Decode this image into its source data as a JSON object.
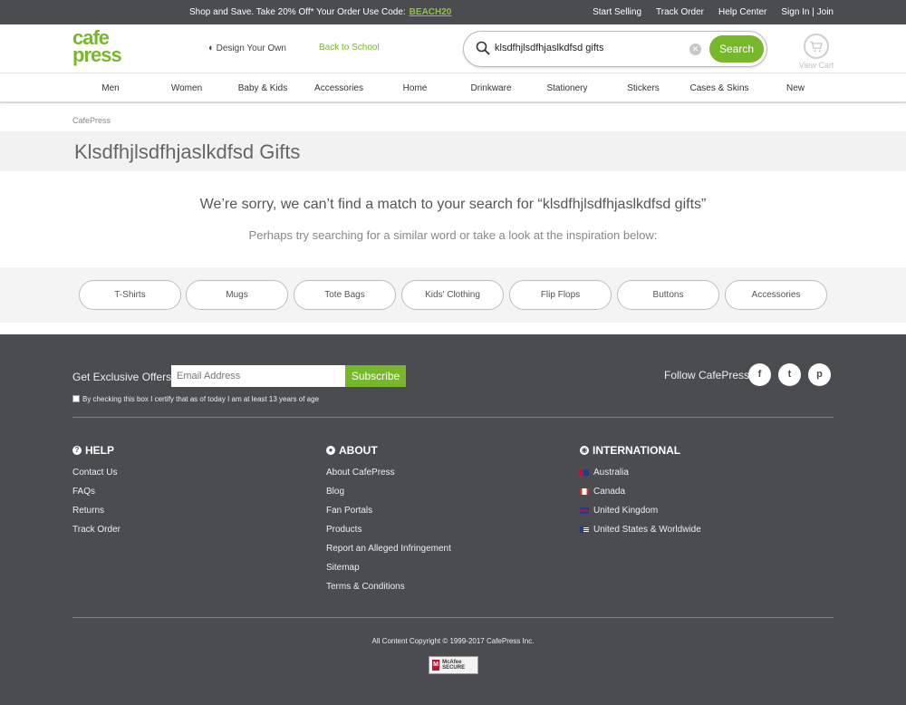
{
  "topbar": {
    "promo_text": "Shop and Save. Take 20% Off* Your Order Use Code:",
    "promo_code": "BEACH20",
    "links": [
      "Start Selling",
      "Track Order",
      "Help Center",
      "Sign In | Join"
    ]
  },
  "header": {
    "logo_line1": "cafe",
    "logo_line2": "press",
    "design_label": "Design Your Own",
    "school_label": "Back to School",
    "search_value": "klsdfhjlsdfhjaslkdfsd gifts",
    "search_button": "Search",
    "cart_label": "View Cart"
  },
  "nav": {
    "items": [
      "Men",
      "Women",
      "Baby & Kids",
      "Accessories",
      "Home",
      "Drinkware",
      "Stationery",
      "Stickers",
      "Cases & Skins",
      "New"
    ]
  },
  "breadcrumb": "CafePress",
  "page_title": "Klsdfhjlsdfhjaslkdfsd Gifts",
  "no_results": {
    "message": "We’re sorry, we can’t find a match to your search for “klsdfhjlsdfhjaslkdfsd gifts”",
    "suggestion": "Perhaps try searching for a similar word or take a look at the inspiration below:"
  },
  "suggestions": [
    "T-Shirts",
    "Mugs",
    "Tote Bags",
    "Kids' Clothing",
    "Flip Flops",
    "Buttons",
    "Accessories"
  ],
  "footer": {
    "offers_label": "Get Exclusive Offers:",
    "email_placeholder": "Email Address",
    "subscribe_label": "Subscribe",
    "checkbox_label": "By checking this box I certify that as of today I am at least 13 years of age",
    "follow_label": "Follow CafePress:",
    "social": {
      "facebook": "f",
      "twitter": "t",
      "pinterest": "p"
    },
    "help": {
      "title": "HELP",
      "links": [
        "Contact Us",
        "FAQs",
        "Returns",
        "Track Order"
      ]
    },
    "about": {
      "title": "ABOUT",
      "links": [
        "About CafePress",
        "Blog",
        "Fan Portals",
        "Products",
        "Report an Alleged Infringement",
        "Sitemap",
        "Terms & Conditions"
      ]
    },
    "international": {
      "title": "INTERNATIONAL",
      "links": [
        "Australia",
        "Canada",
        "United Kingdom",
        "United States & Worldwide"
      ]
    },
    "copyright": "All Content Copyright © 1999-2017 CafePress Inc.",
    "badge": "McAfee SECURE"
  },
  "colors": {
    "brand_green": "#77b82a",
    "footer_bg": "#4a4c4f",
    "topbar_bg": "#4a4c4f"
  }
}
